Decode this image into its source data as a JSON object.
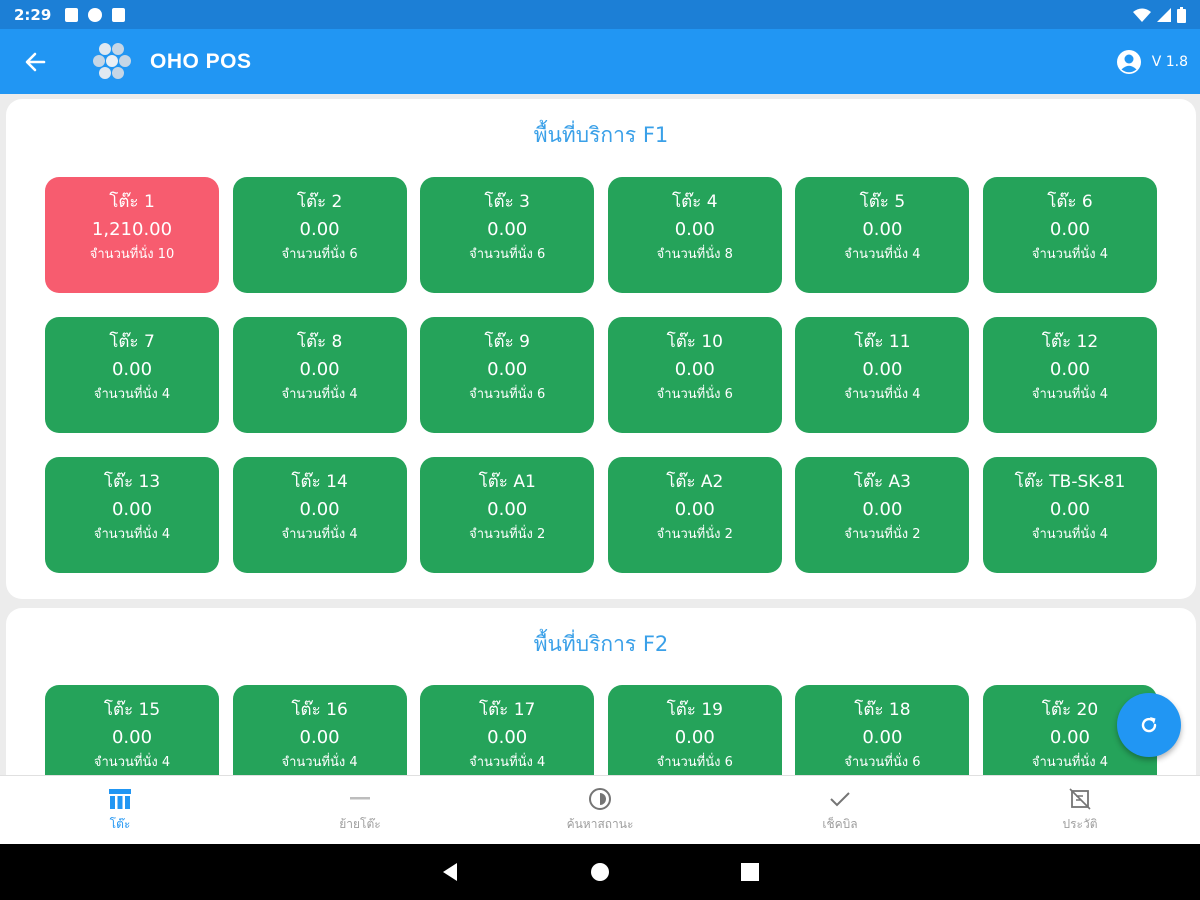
{
  "status_bar": {
    "time": "2:29"
  },
  "app_bar": {
    "title": "OHO POS",
    "version": "V 1.8"
  },
  "zones": [
    {
      "title": "พื้นที่บริการ F1",
      "tables": [
        {
          "name": "โต๊ะ 1",
          "amount": "1,210.00",
          "seats": "จำนวนที่นั่ง 10",
          "occupied": true
        },
        {
          "name": "โต๊ะ 2",
          "amount": "0.00",
          "seats": "จำนวนที่นั่ง 6",
          "occupied": false
        },
        {
          "name": "โต๊ะ 3",
          "amount": "0.00",
          "seats": "จำนวนที่นั่ง 6",
          "occupied": false
        },
        {
          "name": "โต๊ะ 4",
          "amount": "0.00",
          "seats": "จำนวนที่นั่ง 8",
          "occupied": false
        },
        {
          "name": "โต๊ะ 5",
          "amount": "0.00",
          "seats": "จำนวนที่นั่ง 4",
          "occupied": false
        },
        {
          "name": "โต๊ะ 6",
          "amount": "0.00",
          "seats": "จำนวนที่นั่ง 4",
          "occupied": false
        },
        {
          "name": "โต๊ะ 7",
          "amount": "0.00",
          "seats": "จำนวนที่นั่ง 4",
          "occupied": false
        },
        {
          "name": "โต๊ะ 8",
          "amount": "0.00",
          "seats": "จำนวนที่นั่ง 4",
          "occupied": false
        },
        {
          "name": "โต๊ะ 9",
          "amount": "0.00",
          "seats": "จำนวนที่นั่ง 6",
          "occupied": false
        },
        {
          "name": "โต๊ะ 10",
          "amount": "0.00",
          "seats": "จำนวนที่นั่ง 6",
          "occupied": false
        },
        {
          "name": "โต๊ะ 11",
          "amount": "0.00",
          "seats": "จำนวนที่นั่ง 4",
          "occupied": false
        },
        {
          "name": "โต๊ะ 12",
          "amount": "0.00",
          "seats": "จำนวนที่นั่ง 4",
          "occupied": false
        },
        {
          "name": "โต๊ะ 13",
          "amount": "0.00",
          "seats": "จำนวนที่นั่ง 4",
          "occupied": false
        },
        {
          "name": "โต๊ะ 14",
          "amount": "0.00",
          "seats": "จำนวนที่นั่ง 4",
          "occupied": false
        },
        {
          "name": "โต๊ะ A1",
          "amount": "0.00",
          "seats": "จำนวนที่นั่ง 2",
          "occupied": false
        },
        {
          "name": "โต๊ะ A2",
          "amount": "0.00",
          "seats": "จำนวนที่นั่ง 2",
          "occupied": false
        },
        {
          "name": "โต๊ะ A3",
          "amount": "0.00",
          "seats": "จำนวนที่นั่ง 2",
          "occupied": false
        },
        {
          "name": "โต๊ะ TB-SK-81",
          "amount": "0.00",
          "seats": "จำนวนที่นั่ง 4",
          "occupied": false
        }
      ]
    },
    {
      "title": "พื้นที่บริการ F2",
      "tables": [
        {
          "name": "โต๊ะ 15",
          "amount": "0.00",
          "seats": "จำนวนที่นั่ง 4",
          "occupied": false
        },
        {
          "name": "โต๊ะ 16",
          "amount": "0.00",
          "seats": "จำนวนที่นั่ง 4",
          "occupied": false
        },
        {
          "name": "โต๊ะ 17",
          "amount": "0.00",
          "seats": "จำนวนที่นั่ง 4",
          "occupied": false
        },
        {
          "name": "โต๊ะ 19",
          "amount": "0.00",
          "seats": "จำนวนที่นั่ง 6",
          "occupied": false
        },
        {
          "name": "โต๊ะ 18",
          "amount": "0.00",
          "seats": "จำนวนที่นั่ง 6",
          "occupied": false
        },
        {
          "name": "โต๊ะ 20",
          "amount": "0.00",
          "seats": "จำนวนที่นั่ง 4",
          "occupied": false
        }
      ]
    }
  ],
  "bottom_nav": [
    {
      "label": "โต๊ะ",
      "icon": "table-icon",
      "active": true
    },
    {
      "label": "ย้ายโต๊ะ",
      "icon": "minus-icon",
      "active": false
    },
    {
      "label": "ค้นหาสถานะ",
      "icon": "status-icon",
      "active": false
    },
    {
      "label": "เช็คบิล",
      "icon": "check-icon",
      "active": false
    },
    {
      "label": "ประวัติ",
      "icon": "history-icon",
      "active": false
    }
  ],
  "colors": {
    "primary": "#2196f3",
    "available": "#25a35a",
    "occupied": "#f75c6f",
    "zone_title": "#3aa0e8"
  }
}
